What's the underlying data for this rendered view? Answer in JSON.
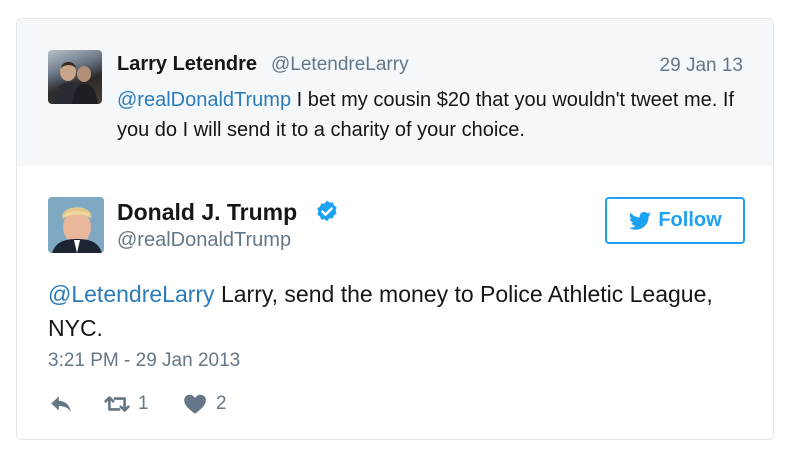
{
  "quoted_tweet": {
    "name": "Larry Letendre",
    "handle": "@LetendreLarry",
    "date": "29 Jan 13",
    "mention": "@realDonaldTrump",
    "text": " I bet my cousin $20 that you wouldn't tweet me. If you do I will send it to a charity of your choice."
  },
  "main_tweet": {
    "name": "Donald J. Trump",
    "handle": "@realDonaldTrump",
    "follow_label": "Follow",
    "mention": "@LetendreLarry",
    "text": " Larry, send the money to Police Athletic League, NYC.",
    "timestamp": "3:21 PM - 29 Jan 2013",
    "retweets": "1",
    "likes": "2"
  },
  "colors": {
    "link": "#2b7bb9",
    "follow": "#1da1f2",
    "muted": "#657786",
    "quoted_bg": "#f5f8fa"
  },
  "icons": [
    "verified-icon",
    "twitter-bird-icon",
    "reply-icon",
    "retweet-icon",
    "heart-icon"
  ]
}
